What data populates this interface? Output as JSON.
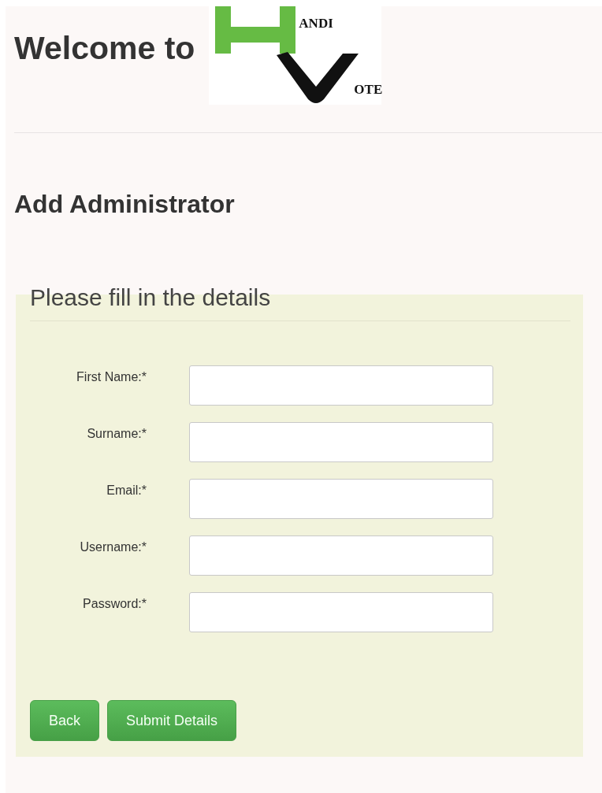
{
  "header": {
    "welcome": "Welcome to",
    "logo": {
      "letters_top": "ANDI",
      "letters_bottom": "OTE"
    }
  },
  "page_title": "Add Administrator",
  "form": {
    "legend": "Please fill in the details",
    "fields": [
      {
        "label": "First Name:*"
      },
      {
        "label": "Surname:*"
      },
      {
        "label": "Email:*"
      },
      {
        "label": "Username:*"
      },
      {
        "label": "Password:*"
      }
    ],
    "buttons": [
      "Back",
      "Submit Details"
    ]
  }
}
